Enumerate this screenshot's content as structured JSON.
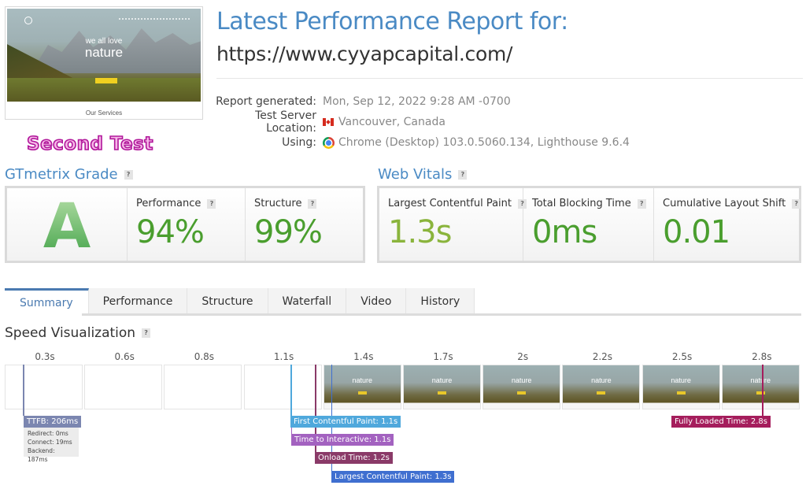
{
  "thumbnail": {
    "hero_small": "we all love",
    "hero_big": "nature",
    "footer_text": "Our Services"
  },
  "annotation": "Second Test",
  "header": {
    "title": "Latest Performance Report for:",
    "url": "https://www.cyyapcapital.com/"
  },
  "meta": {
    "report_generated_label": "Report generated:",
    "report_generated_value": "Mon, Sep 12, 2022 9:28 AM -0700",
    "location_label": "Test Server Location:",
    "location_value": "Vancouver, Canada",
    "location_flag_icon": "canada-flag-icon",
    "using_label": "Using:",
    "using_value": "Chrome (Desktop) 103.0.5060.134, Lighthouse 9.6.4",
    "using_icon": "chrome-icon"
  },
  "gtmetrix_grade": {
    "title": "GTmetrix Grade",
    "help": "?",
    "grade": "A",
    "performance_label": "Performance",
    "performance_value": "94%",
    "structure_label": "Structure",
    "structure_value": "99%"
  },
  "web_vitals": {
    "title": "Web Vitals",
    "help": "?",
    "lcp_label": "Largest Contentful Paint",
    "lcp_value": "1.3s",
    "tbt_label": "Total Blocking Time",
    "tbt_value": "0ms",
    "cls_label": "Cumulative Layout Shift",
    "cls_value": "0.01"
  },
  "colors": {
    "accent_blue": "#4a8ac4",
    "good_green": "#4a9e2e",
    "lcp_green": "#8ab43c"
  },
  "tabs": [
    {
      "label": "Summary",
      "active": true
    },
    {
      "label": "Performance",
      "active": false
    },
    {
      "label": "Structure",
      "active": false
    },
    {
      "label": "Waterfall",
      "active": false
    },
    {
      "label": "Video",
      "active": false
    },
    {
      "label": "History",
      "active": false
    }
  ],
  "speed_visualization": {
    "title": "Speed Visualization",
    "help": "?",
    "frames": [
      {
        "time": "0.3s",
        "loaded": false
      },
      {
        "time": "0.6s",
        "loaded": false
      },
      {
        "time": "0.8s",
        "loaded": false
      },
      {
        "time": "1.1s",
        "loaded": false
      },
      {
        "time": "1.4s",
        "loaded": true
      },
      {
        "time": "1.7s",
        "loaded": true
      },
      {
        "time": "2s",
        "loaded": true
      },
      {
        "time": "2.2s",
        "loaded": true
      },
      {
        "time": "2.5s",
        "loaded": true
      },
      {
        "time": "2.8s",
        "loaded": true
      }
    ],
    "frame_caption": "nature",
    "markers": {
      "ttfb": {
        "label": "TTFB: 206ms",
        "color": "#7b86b0"
      },
      "fcp": {
        "label": "First Contentful Paint: 1.1s",
        "color": "#4fa8dc"
      },
      "tti": {
        "label": "Time to Interactive: 1.1s",
        "color": "#a362c0"
      },
      "onload": {
        "label": "Onload Time: 1.2s",
        "color": "#8a3a68"
      },
      "lcp": {
        "label": "Largest Contentful Paint: 1.3s",
        "color": "#3f6fd0"
      },
      "fully_loaded": {
        "label": "Fully Loaded Time: 2.8s",
        "color": "#a51d5c"
      }
    },
    "ttfb_breakdown": {
      "redirect": "Redirect: 0ms",
      "connect": "Connect: 19ms",
      "backend": "Backend: 187ms"
    }
  }
}
